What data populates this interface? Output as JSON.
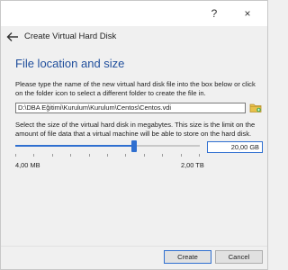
{
  "window": {
    "help_label": "?",
    "close_label": "×"
  },
  "header": {
    "title": "Create Virtual Hard Disk"
  },
  "section": {
    "title": "File location and size"
  },
  "location": {
    "description": "Please type the name of the new virtual hard disk file into the box below or click on the folder icon to select a different folder to create the file in.",
    "path_value": "D:\\DBA Eğitimi\\Kurulum\\Kurulum\\Centos\\Centos.vdi"
  },
  "size": {
    "description": "Select the size of the virtual hard disk in megabytes. This size is the limit on the amount of file data that a virtual machine will be able to store on the hard disk.",
    "value": "20,00 GB",
    "min_label": "4,00 MB",
    "max_label": "2,00 TB",
    "slider_fraction": 0.65
  },
  "buttons": {
    "create": "Create",
    "cancel": "Cancel"
  },
  "colors": {
    "accent": "#2f6fd0",
    "section_title": "#1f4e9c"
  },
  "icons": {
    "back": "back-arrow-icon",
    "folder": "folder-icon"
  }
}
